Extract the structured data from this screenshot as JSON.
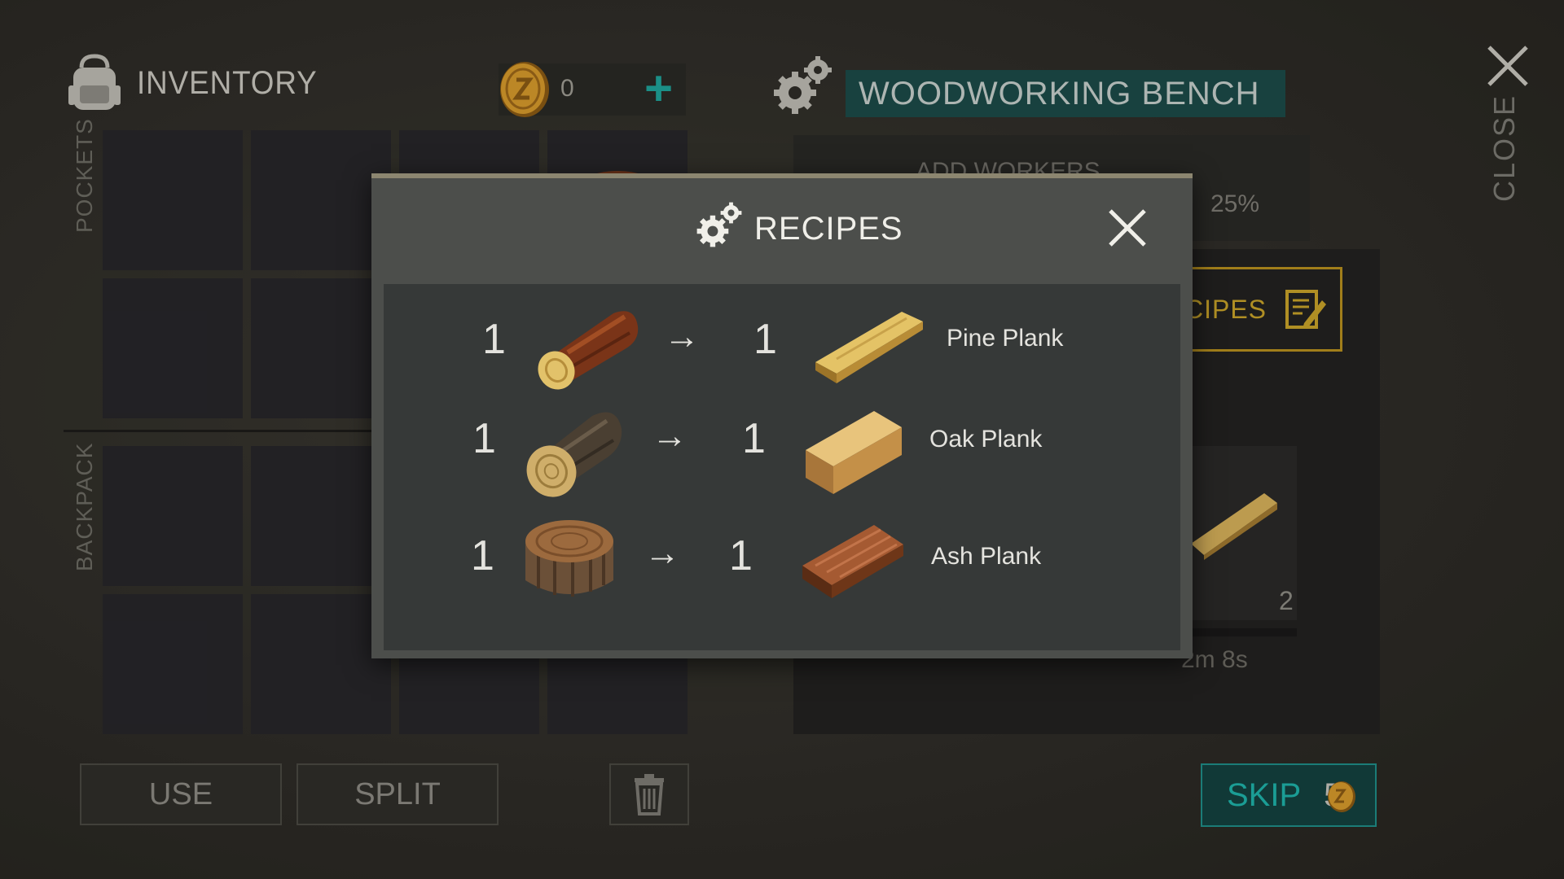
{
  "inventory": {
    "title": "INVENTORY",
    "coins": "0",
    "add_label": "+",
    "pockets_label": "POCKETS",
    "backpack_label": "BACKPACK",
    "use_label": "USE",
    "split_label": "SPLIT"
  },
  "bench": {
    "title": "WOODWORKING BENCH",
    "workers_label": "ADD WORKERS",
    "workers_bonus": "25%",
    "recipes_label": "RECIPES",
    "craft_count": "2",
    "timer": "2m 8s",
    "progress": 0.06,
    "skip_label": "SKIP",
    "skip_cost": "5"
  },
  "close_label": "CLOSE",
  "modal": {
    "title": "RECIPES",
    "recipes": [
      {
        "in_qty": "1",
        "input_icon": "pine-log-icon",
        "arrow": "→",
        "out_qty": "1",
        "output_icon": "pine-plank-icon",
        "name": "Pine Plank"
      },
      {
        "in_qty": "1",
        "input_icon": "oak-log-icon",
        "arrow": "→",
        "out_qty": "1",
        "output_icon": "oak-plank-icon",
        "name": "Oak Plank"
      },
      {
        "in_qty": "1",
        "input_icon": "ash-log-icon",
        "arrow": "→",
        "out_qty": "1",
        "output_icon": "ash-plank-icon",
        "name": "Ash Plank"
      }
    ]
  },
  "colors": {
    "accent_teal": "#1fa39a",
    "accent_gold": "#c9a32a",
    "bench_title_bg": "#1c4a48"
  }
}
